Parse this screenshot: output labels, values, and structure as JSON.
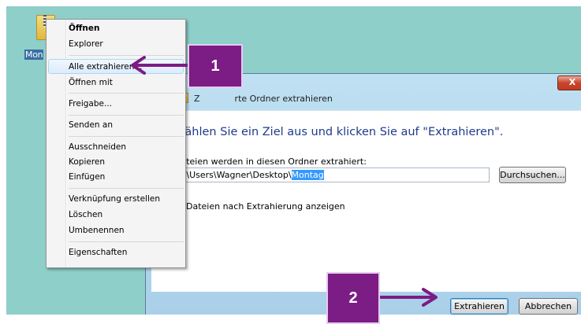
{
  "desktop": {
    "icon_name": "zip-folder-icon",
    "icon_label": "Mon"
  },
  "context_menu": {
    "items": [
      {
        "label": "Öffnen",
        "bold": true
      },
      {
        "label": "Explorer"
      },
      {
        "label": "Alle extrahieren...",
        "highlighted": true
      },
      {
        "label": "Öffnen mit"
      },
      {
        "label": "Freigabe..."
      },
      {
        "label": "Senden an"
      },
      {
        "label": "Ausschneiden"
      },
      {
        "label": "Kopieren"
      },
      {
        "label": "Einfügen"
      },
      {
        "label": "Verknüpfung erstellen"
      },
      {
        "label": "Löschen"
      },
      {
        "label": "Umbenennen"
      },
      {
        "label": "Eigenschaften"
      }
    ]
  },
  "dialog": {
    "close_label": "X",
    "title_start": "Z",
    "title_end": "rte Ordner extrahieren",
    "heading": "Wählen Sie ein Ziel aus und klicken Sie auf \"Extrahieren\".",
    "destination_label": "Dateien werden in diesen Ordner extrahiert:",
    "path_prefix": "C:\\Users\\Wagner\\Desktop\\",
    "path_selected": "Montag",
    "browse_button": "Durchsuchen...",
    "checkbox_label": "Dateien nach Extrahierung anzeigen",
    "checkbox_checked": false,
    "extract_button": "Extrahieren",
    "cancel_button": "Abbrechen"
  },
  "annotations": {
    "step1": "1",
    "step2": "2",
    "badge_color": "#7c1c85",
    "arrow_color": "#7c1c85"
  },
  "colors": {
    "desktop": "#8ecfc9",
    "heading": "#1e3b8a",
    "selection": "#3399ff"
  }
}
